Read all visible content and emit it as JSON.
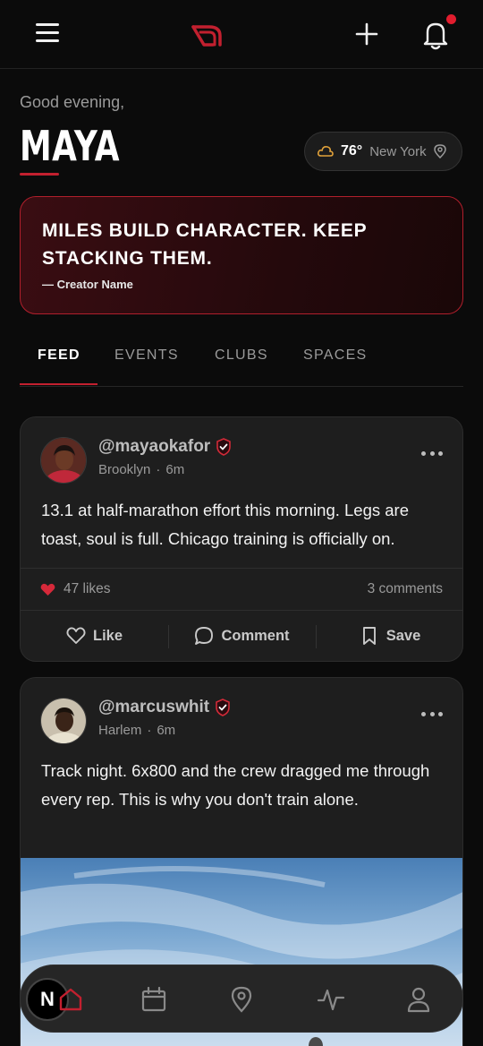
{
  "header": {
    "menu_icon": "hamburger-menu-icon",
    "logo_icon": "brand-logo-icon",
    "add_icon": "plus-icon",
    "notification_icon": "bell-icon",
    "accent_color": "#c2202f"
  },
  "greeting": {
    "salutation": "Good evening,",
    "name": "MAYA"
  },
  "weather": {
    "temperature": "76°",
    "city": "New York",
    "icon": "cloud-icon"
  },
  "quote": {
    "text": "Miles build character. Keep stacking them.",
    "author": "— Creator Name"
  },
  "tabs": [
    {
      "label": "FEED",
      "active": true
    },
    {
      "label": "EVENTS",
      "active": false
    },
    {
      "label": "CLUBS",
      "active": false
    },
    {
      "label": "SPACES",
      "active": false
    }
  ],
  "posts": [
    {
      "handle": "@mayaokafor",
      "location": "Brooklyn",
      "time": "6m",
      "text": "13.1 at half-marathon effort this morning. Legs are toast, soul is full. Chicago training is officially on.",
      "likes": "47 likes",
      "comments": "3 comments",
      "actions": {
        "like": "Like",
        "comment": "Comment",
        "save": "Save"
      }
    },
    {
      "handle": "@marcuswhit",
      "location": "Harlem",
      "time": "6m",
      "text": "Track night. 6x800 and the crew dragged me through every rep. This is why you don't train alone."
    }
  ],
  "bottom_nav": {
    "badge": "N",
    "items": [
      "home-icon",
      "calendar-icon",
      "map-pin-icon",
      "activity-icon",
      "profile-icon"
    ]
  }
}
